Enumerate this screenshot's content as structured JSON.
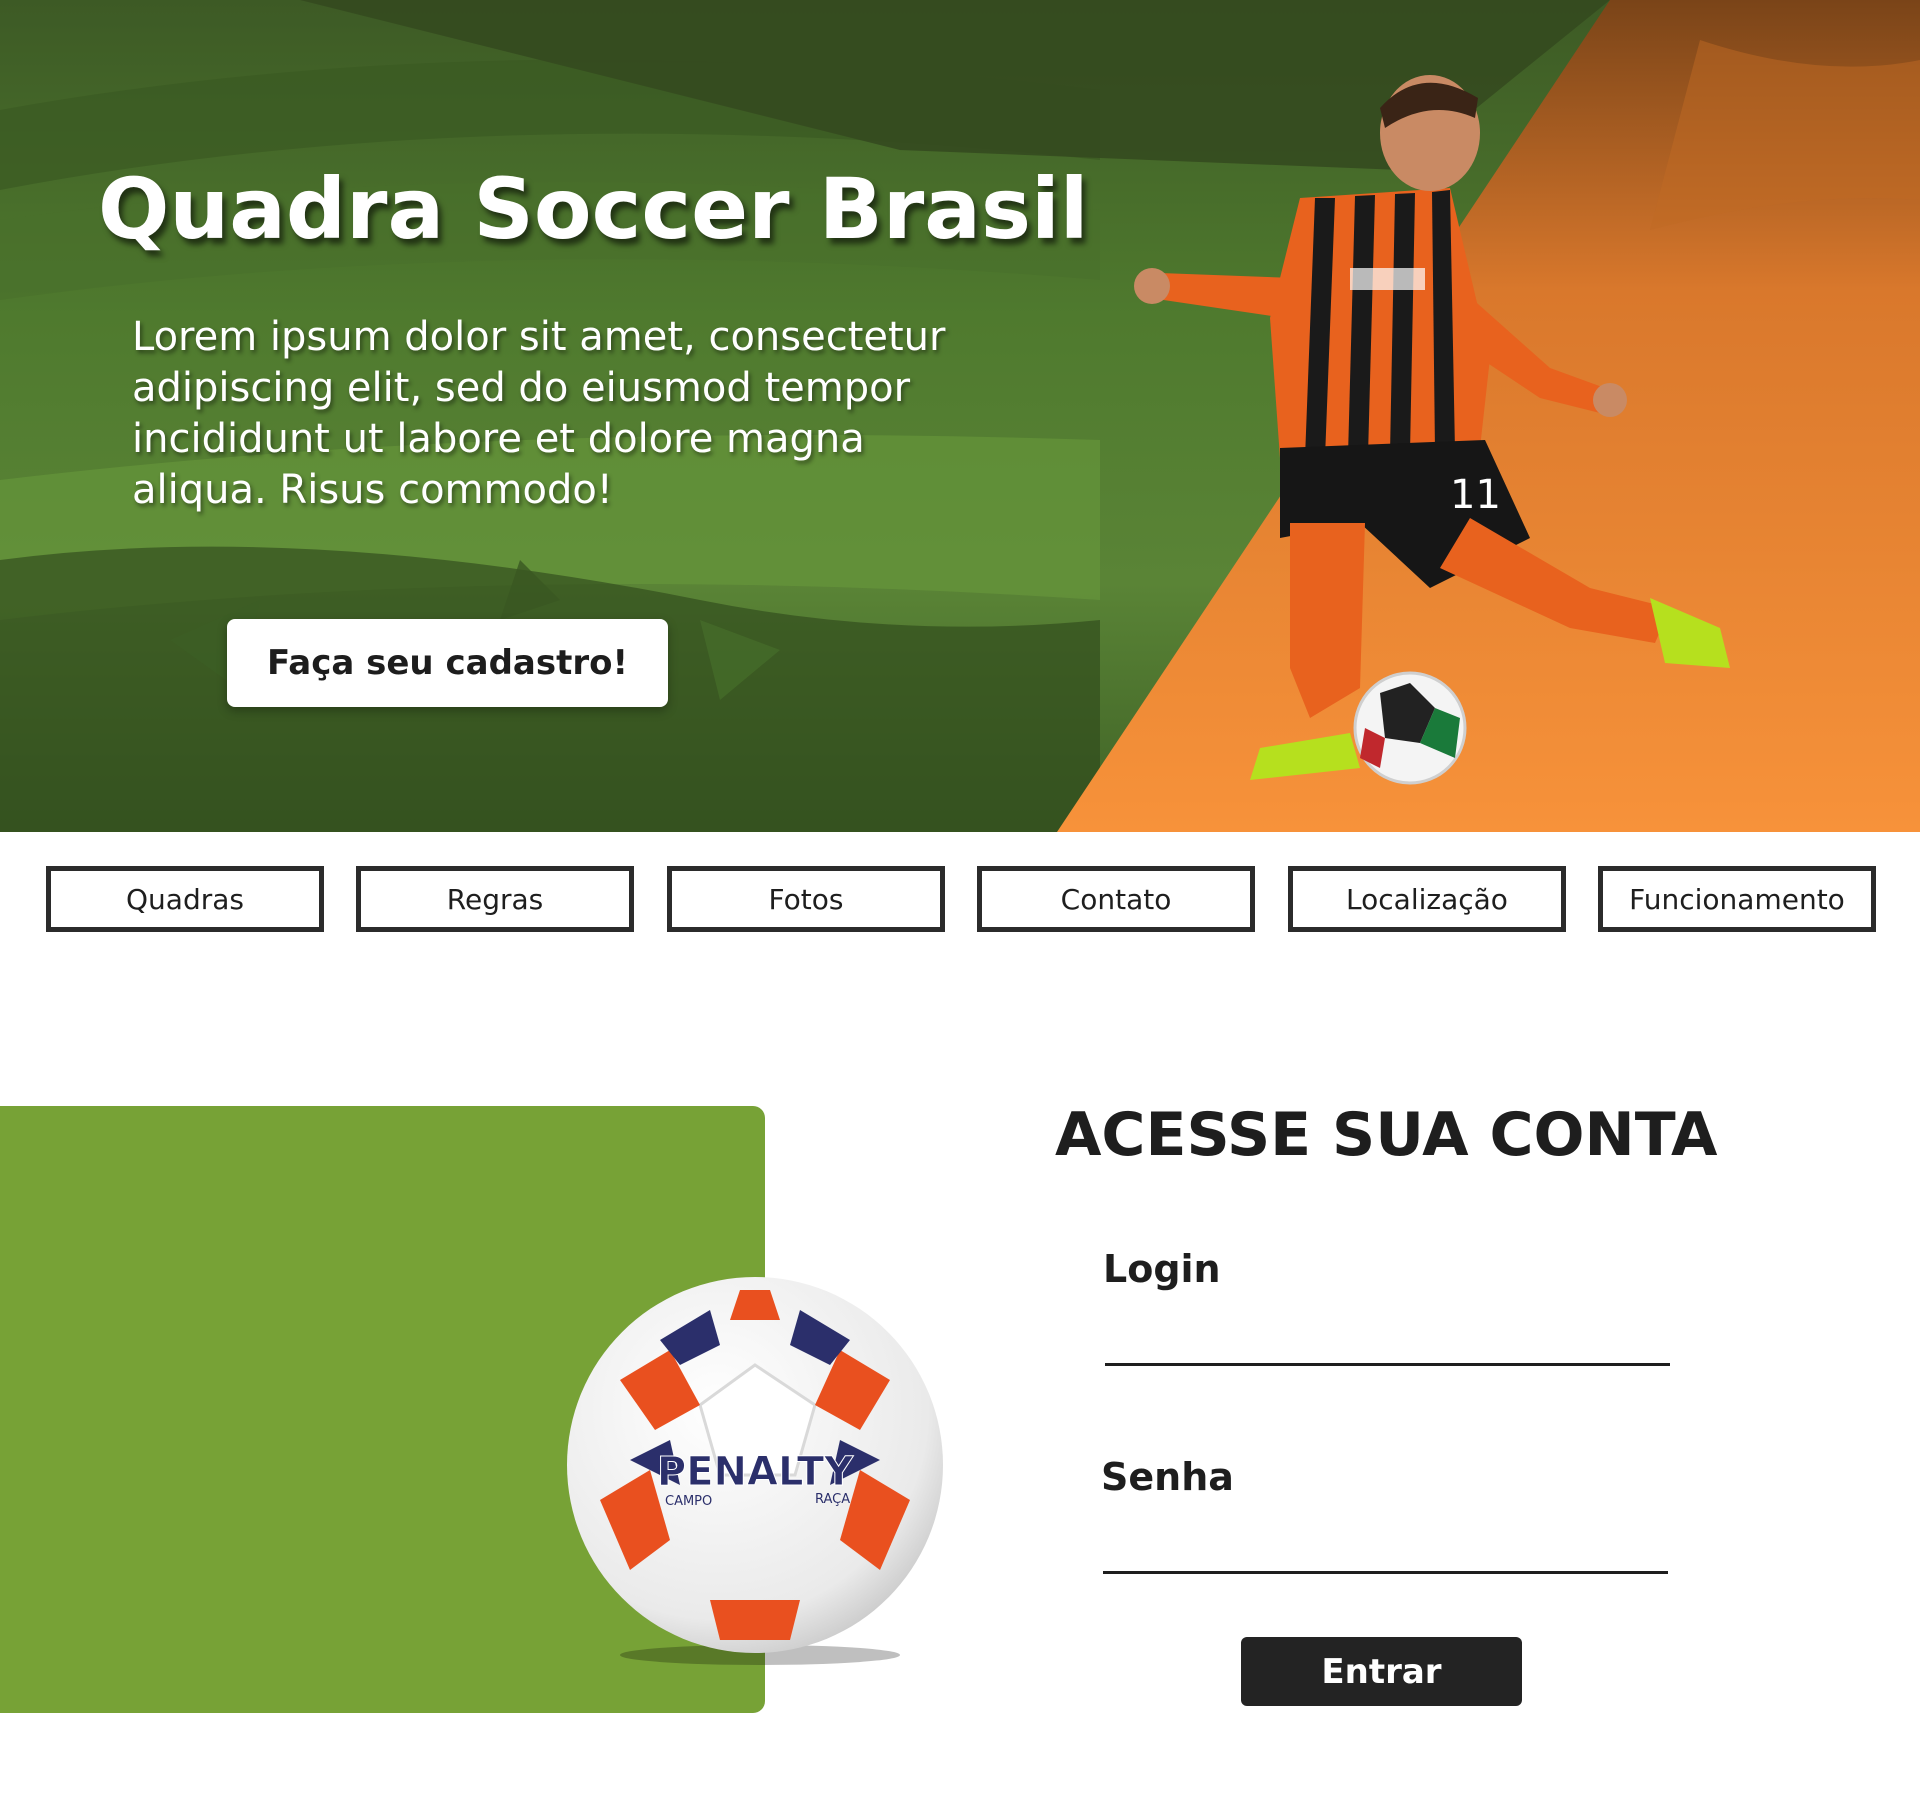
{
  "hero": {
    "title": "Quadra Soccer Brasil",
    "description": "Lorem ipsum dolor sit amet, consectetur adipiscing elit, sed do eiusmod tempor incididunt ut labore et dolore magna aliqua. Risus commodo!",
    "cta_label": "Faça seu cadastro!",
    "player_number": "11"
  },
  "nav": {
    "items": [
      {
        "label": "Quadras"
      },
      {
        "label": "Regras"
      },
      {
        "label": "Fotos"
      },
      {
        "label": "Contato"
      },
      {
        "label": "Localização"
      },
      {
        "label": "Funcionamento"
      }
    ]
  },
  "login": {
    "title": "ACESSE SUA CONTA",
    "login_label": "Login",
    "login_value": "",
    "password_label": "Senha",
    "password_value": "",
    "submit_label": "Entrar"
  },
  "ball": {
    "brand": "PENALTY",
    "line1": "CAMPO",
    "line2": "RAÇA"
  },
  "colors": {
    "hero_green": "#4f7a2e",
    "hero_orange": "#f7923a",
    "panel_green": "#77a236",
    "dark": "#232323",
    "white": "#ffffff"
  }
}
